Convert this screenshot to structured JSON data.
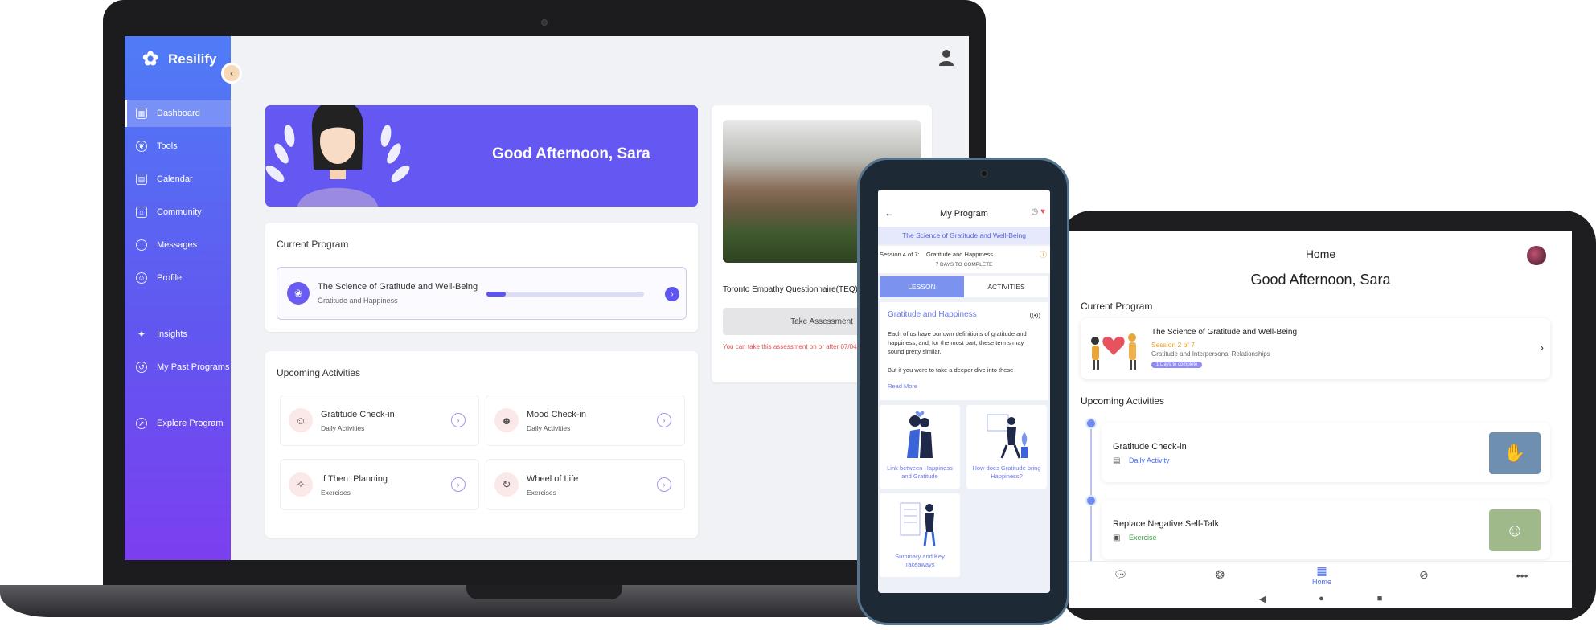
{
  "laptop": {
    "brand": "Resilify",
    "sidebar": {
      "items": [
        {
          "label": "Dashboard",
          "icon": "grid-icon"
        },
        {
          "label": "Tools",
          "icon": "leaf-icon"
        },
        {
          "label": "Calendar",
          "icon": "calendar-icon"
        },
        {
          "label": "Community",
          "icon": "community-icon"
        },
        {
          "label": "Messages",
          "icon": "chat-icon"
        },
        {
          "label": "Profile",
          "icon": "profile-icon"
        },
        {
          "label": "Insights",
          "icon": "lamp-icon"
        },
        {
          "label": "My Past Programs",
          "icon": "history-icon"
        },
        {
          "label": "Explore Program",
          "icon": "compass-icon"
        }
      ]
    },
    "hero": {
      "greeting": "Good Afternoon, Sara"
    },
    "current_program": {
      "heading": "Current Program",
      "title": "The Science of Gratitude and Well-Being",
      "subtitle": "Gratitude and Happiness",
      "progress": 0.12
    },
    "upcoming": {
      "heading": "Upcoming Activities",
      "items": [
        {
          "title": "Gratitude Check-in",
          "sub": "Daily Activities",
          "icon": "face-icon"
        },
        {
          "title": "Mood Check-in",
          "sub": "Daily Activities",
          "icon": "mood-icon"
        },
        {
          "title": "If Then: Planning",
          "sub": "Exercises",
          "icon": "bulb-icon"
        },
        {
          "title": "Wheel of Life",
          "sub": "Exercises",
          "icon": "cycle-icon"
        }
      ]
    },
    "assessment": {
      "title": "Toronto Empathy Questionnaire(TEQ)",
      "button": "Take Assessment",
      "note": "You can take this assessment on or after 07/04/20"
    }
  },
  "phone": {
    "header_title": "My Program",
    "program": "The Science of Gratitude and Well-Being",
    "session_label": "Session 4 of 7:",
    "session_title": "Gratitude and Happiness",
    "days": "7 DAYS TO COMPLETE",
    "tabs": [
      "LESSON",
      "ACTIVITIES"
    ],
    "lesson_title": "Gratitude and Happiness",
    "lesson_body": "Each of us have our own definitions of gratitude and happiness, and, for the most part, these terms may sound pretty similar.",
    "lesson_body2": "But if you were to take a deeper dive into these",
    "read_more": "Read More",
    "tiles": [
      "Link between Happiness and Gratitude",
      "How does Gratitude bring Happiness?",
      "Summary and Key Takeaways"
    ]
  },
  "tablet": {
    "header": "Home",
    "greeting": "Good Afternoon, Sara",
    "current_heading": "Current Program",
    "program_title": "The Science of Gratitude and Well-Being",
    "session": "Session 2 of 7",
    "session_sub": "Gratitude and Interpersonal Relationships",
    "badge": "1 Days to complete",
    "upcoming_heading": "Upcoming Activities",
    "activities": [
      {
        "title": "Gratitude Check-in",
        "sub": "Daily Activity",
        "sub_color": "#4a6df0",
        "img_color": "#6f8fb0"
      },
      {
        "title": "Replace Negative Self-Talk",
        "sub": "Exercise",
        "sub_color": "#43a047",
        "img_color": "#9fb98a"
      }
    ],
    "nav": [
      {
        "icon": "chat-icon",
        "label": ""
      },
      {
        "icon": "brain-icon",
        "label": ""
      },
      {
        "icon": "home-icon",
        "label": "Home"
      },
      {
        "icon": "compass-icon",
        "label": ""
      },
      {
        "icon": "more-icon",
        "label": ""
      }
    ]
  },
  "colors": {
    "accent": "#6457f2",
    "sidebar_top": "#4f7cf6",
    "sidebar_bottom": "#7b3ff0"
  }
}
